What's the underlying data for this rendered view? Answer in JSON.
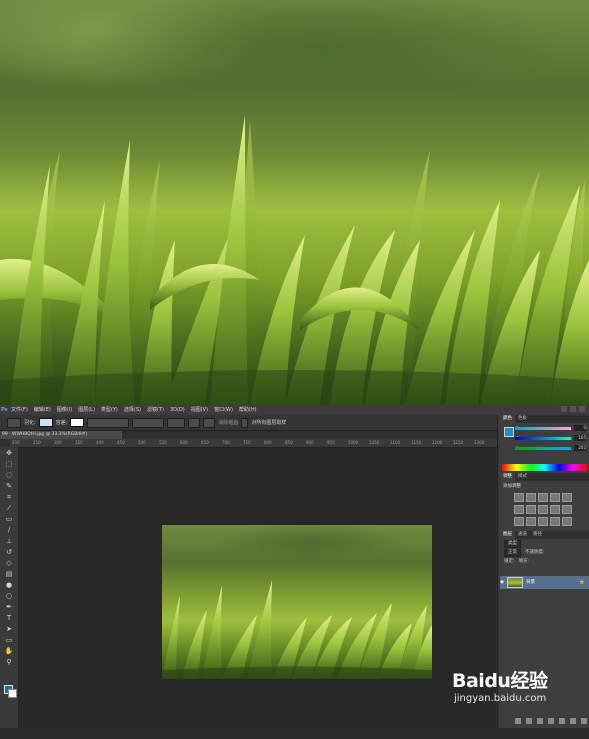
{
  "menubar": {
    "logo": "Ps",
    "items": [
      "文件(F)",
      "编辑(E)",
      "图像(I)",
      "图层(L)",
      "类型(Y)",
      "选择(S)",
      "滤镜(T)",
      "3D(D)",
      "视图(V)",
      "窗口(W)",
      "帮助(H)"
    ]
  },
  "options_bar": {
    "mode_label": "羽化:",
    "tolerance_label": "容差:",
    "antialias_label": "消除锯齿",
    "sample_label": "对所有图层取样"
  },
  "document": {
    "tab": "99 · WWH8QtH.jpg @ 33.3%(RGB/8#)"
  },
  "ruler": {
    "ticks": [
      "200",
      "250",
      "300",
      "350",
      "400",
      "450",
      "500",
      "550",
      "600",
      "650",
      "700",
      "750",
      "800",
      "850",
      "900",
      "950",
      "1000",
      "1050",
      "1100",
      "1150",
      "1200",
      "1250",
      "1300"
    ]
  },
  "color_panel": {
    "tabs": [
      "颜色",
      "色板"
    ],
    "values": {
      "r": "0",
      "g": "165",
      "b": "202"
    },
    "labels": {
      "r": "R",
      "g": "G",
      "b": "B"
    },
    "fg_color": "#1e90c7"
  },
  "adjustments": {
    "tabs": [
      "调整",
      "样式"
    ],
    "title": "添加调整"
  },
  "layers_panel": {
    "tabs": [
      "图层",
      "通道",
      "路径"
    ],
    "kind_label": "类型",
    "blend_mode": "正常",
    "opacity_label": "不透明度:",
    "lock_label": "锁定:",
    "fill_label": "填充:",
    "layer_name": "背景"
  },
  "watermark": {
    "brand": "Baidu经验",
    "url": "jingyan.baidu.com"
  }
}
